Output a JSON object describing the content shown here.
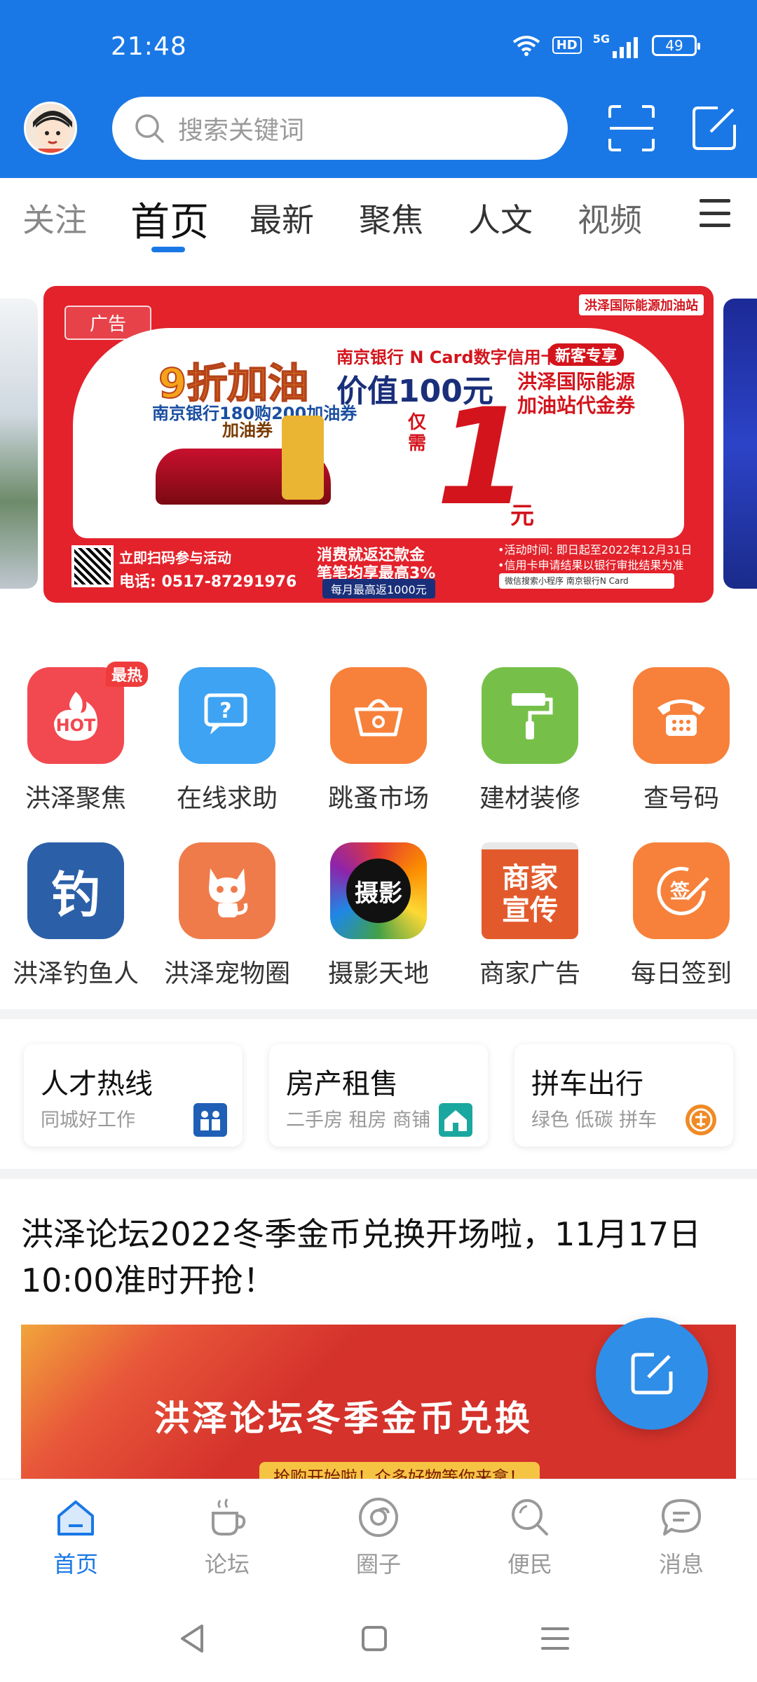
{
  "status": {
    "time": "21:48",
    "network": "5G",
    "hd": "HD",
    "battery": "49"
  },
  "header": {
    "search_placeholder": "搜索关键词"
  },
  "tabs": [
    {
      "label": "关注",
      "active": false
    },
    {
      "label": "首页",
      "active": true
    },
    {
      "label": "最新",
      "active": false
    },
    {
      "label": "聚焦",
      "active": false
    },
    {
      "label": "人文",
      "active": false
    },
    {
      "label": "视频",
      "active": false
    }
  ],
  "banner": {
    "ad_tag": "广告",
    "top_right": "洪泽国际能源加油站",
    "headline": "9折加油",
    "subline": "南京银行180购200加油券",
    "gift_label": "加油券",
    "bank_line": "南京银行  N Card数字信用卡",
    "new_customer": "新客专享",
    "value_line": "价值100元",
    "station_line1": "洪泽国际能源",
    "station_line2": "加油站代金券",
    "only_label": "仅需",
    "price": "1",
    "unit": "元",
    "scan_text": "立即扫码参与活动",
    "phone": "电话: 0517-87291976",
    "rebate_line1": "消费就返还款金",
    "rebate_line2": "笔笔均享最高3%",
    "monthly_max": "每月最高返1000元",
    "note_line1": "•活动时间: 即日起至2022年12月31日",
    "note_line2": "•信用卡申请结果以银行审批结果为准",
    "search_hint": "微信搜索小程序  南京银行N Card"
  },
  "grid": [
    {
      "label": "洪泽聚焦",
      "badge": "最热",
      "glyph": "HOT",
      "color": "#f2484f"
    },
    {
      "label": "在线求助",
      "glyph": "?",
      "color": "#3ea3f2"
    },
    {
      "label": "跳蚤市场",
      "glyph": "🧺",
      "color": "#f7813a"
    },
    {
      "label": "建材装修",
      "glyph": "🖌",
      "color": "#76c04a"
    },
    {
      "label": "查号码",
      "glyph": "☎",
      "color": "#f7813a"
    },
    {
      "label": "洪泽钓鱼人",
      "glyph": "钓",
      "color": "#2b5fa8"
    },
    {
      "label": "洪泽宠物圈",
      "glyph": "🐱",
      "color": "#ef7b4b"
    },
    {
      "label": "摄影天地",
      "glyph": "摄影",
      "color": "#7b2fbf"
    },
    {
      "label": "商家广告",
      "glyph": "商家宣传",
      "color": "#e25a2c"
    },
    {
      "label": "每日签到",
      "glyph": "签",
      "color": "#f7813a"
    }
  ],
  "cards": [
    {
      "title": "人才热线",
      "sub": "同城好工作",
      "icon_color": "#1f5fb6"
    },
    {
      "title": "房产租售",
      "sub": "二手房 租房 商铺",
      "icon_color": "#1aa7a0"
    },
    {
      "title": "拼车出行",
      "sub": "绿色 低碳  拼车",
      "icon_color": "#f08a24"
    }
  ],
  "article": {
    "title": "洪泽论坛2022冬季金币兑换开场啦，11月17日10:00准时开抢！",
    "image_title": "洪泽论坛冬季金币兑换",
    "image_sub": "抢购开始啦！众多好物等你来拿！"
  },
  "bottom_nav": [
    {
      "label": "首页",
      "active": true
    },
    {
      "label": "论坛",
      "active": false
    },
    {
      "label": "圈子",
      "active": false
    },
    {
      "label": "便民",
      "active": false
    },
    {
      "label": "消息",
      "active": false
    }
  ],
  "colors": {
    "brand": "#1a78e6",
    "banner_red": "#e3222b"
  }
}
